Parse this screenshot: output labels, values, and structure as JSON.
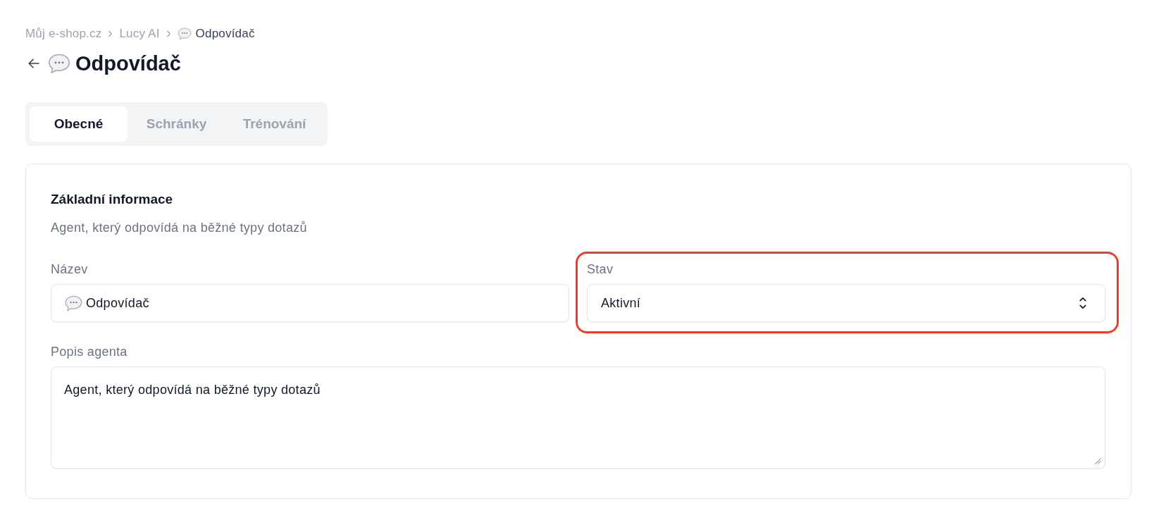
{
  "breadcrumbs": [
    {
      "label": "Můj e-shop.cz",
      "current": false,
      "prefix_icon": false
    },
    {
      "label": "Lucy AI",
      "current": false,
      "prefix_icon": false
    },
    {
      "label": "Odpovídač",
      "current": true,
      "prefix_icon": true
    }
  ],
  "header": {
    "title": "Odpovídač"
  },
  "tabs": [
    {
      "label": "Obecné",
      "selected": true
    },
    {
      "label": "Schránky",
      "selected": false
    },
    {
      "label": "Trénování",
      "selected": false
    }
  ],
  "section": {
    "title": "Základní informace",
    "description": "Agent, který odpovídá na běžné typy dotazů",
    "fields": [
      {
        "kind": "text",
        "label": "Název",
        "value": "Odpovídač",
        "prefix_icon": true,
        "highlighted": false
      },
      {
        "kind": "select",
        "label": "Stav",
        "value": "Aktivní",
        "prefix_icon": false,
        "highlighted": true
      },
      {
        "kind": "textarea",
        "label": "Popis agenta",
        "value": "Agent, který odpovídá na běžné typy dotazů",
        "prefix_icon": false,
        "highlighted": false
      }
    ]
  }
}
